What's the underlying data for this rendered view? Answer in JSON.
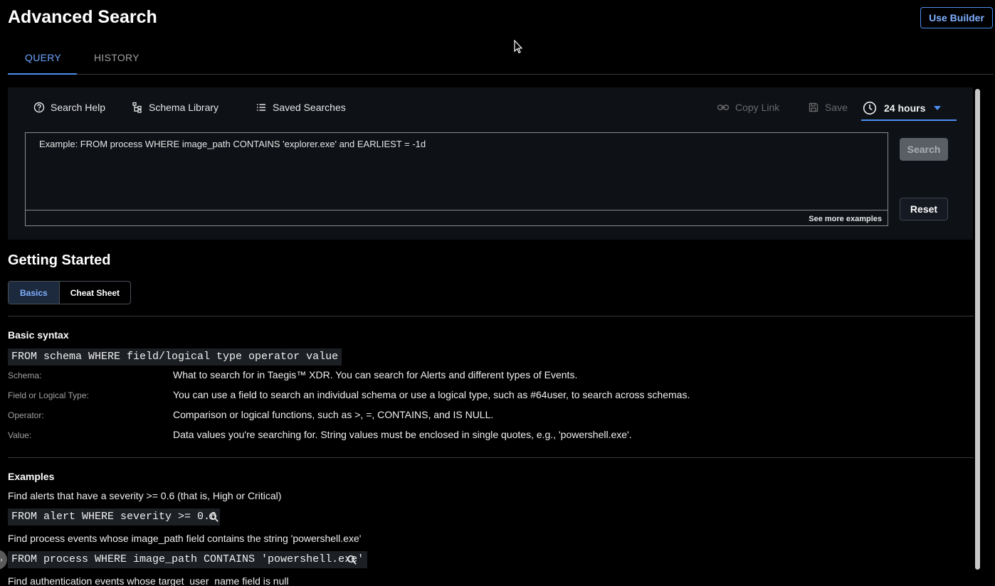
{
  "header": {
    "title": "Advanced Search",
    "use_builder_label": "Use Builder"
  },
  "tabs": [
    {
      "label": "QUERY",
      "active": true
    },
    {
      "label": "HISTORY",
      "active": false
    }
  ],
  "toolbar": {
    "search_help": "Search Help",
    "schema_library": "Schema Library",
    "saved_searches": "Saved Searches",
    "copy_link": "Copy Link",
    "save": "Save",
    "time_range": "24 hours"
  },
  "query": {
    "placeholder": "Example: FROM process WHERE image_path CONTAINS 'explorer.exe' and EARLIEST = -1d",
    "value": "",
    "see_more": "See more examples",
    "search_label": "Search",
    "reset_label": "Reset"
  },
  "getting_started": {
    "title": "Getting Started",
    "segments": [
      {
        "label": "Basics",
        "active": true
      },
      {
        "label": "Cheat Sheet",
        "active": false
      }
    ],
    "basic_syntax": {
      "heading": "Basic syntax",
      "code": "FROM schema WHERE field/logical type operator value",
      "definitions": [
        {
          "label": "Schema:",
          "value": "What to search for in Taegis™ XDR. You can search for Alerts and different types of Events."
        },
        {
          "label": "Field or Logical Type:",
          "value": "You can use a field to search an individual schema or use a logical type, such as #64user, to search across schemas."
        },
        {
          "label": "Operator:",
          "value": "Comparison or logical functions, such as >, =, CONTAINS, and IS NULL."
        },
        {
          "label": "Value:",
          "value": "Data values you're searching for. String values must be enclosed in single quotes, e.g., 'powershell.exe'."
        }
      ]
    },
    "examples": {
      "heading": "Examples",
      "items": [
        {
          "description": "Find alerts that have a severity >= 0.6 (that is, High or Critical)",
          "query": "FROM alert WHERE severity >= 0.6"
        },
        {
          "description": "Find process events whose image_path field contains the string 'powershell.exe'",
          "query": "FROM process WHERE image_path CONTAINS 'powershell.exe'"
        },
        {
          "description": "Find authentication events whose target_user_name field is null",
          "query": ""
        }
      ]
    }
  },
  "colors": {
    "accent": "#4d8ef0",
    "background": "#000000",
    "panel": "#0e1116"
  }
}
